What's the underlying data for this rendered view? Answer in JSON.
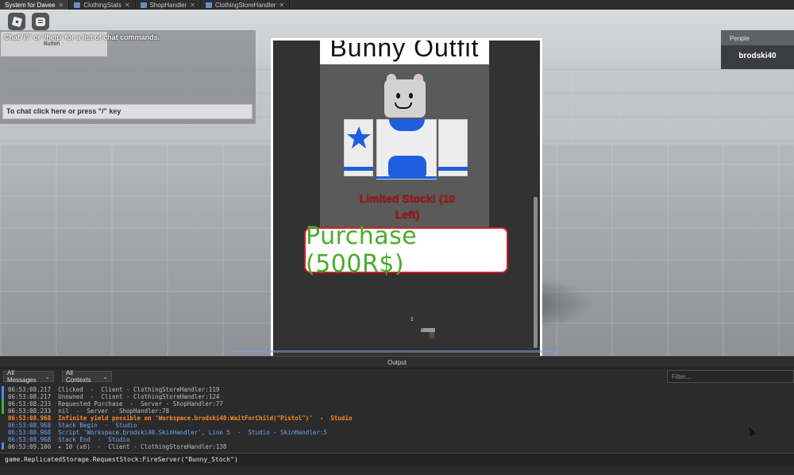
{
  "tabs": [
    {
      "label": "System for Davee",
      "active": true
    },
    {
      "label": "ClothingStats",
      "active": false
    },
    {
      "label": "ShopHandler",
      "active": false
    },
    {
      "label": "ClothingStoreHandler",
      "active": false
    }
  ],
  "chat": {
    "system_message": "Chat '/?' or '/help' for a list of chat commands.",
    "button_label": "Button",
    "input_placeholder": "To chat click here or press \"/\" key"
  },
  "people": {
    "title": "People",
    "players": [
      "brodski40"
    ]
  },
  "shop": {
    "title": "Bunny Outfit",
    "stock_text": "Limited Stock! (10 Left)",
    "purchase_label": "Purchase (500R$)",
    "hotbar_slot": "1"
  },
  "output": {
    "title": "Output",
    "filter_messages": "All Messages",
    "filter_contexts": "All Contexts",
    "filter_placeholder": "Filter...",
    "lines": [
      {
        "text": "06:53:08.217  Clicked  -  Client - ClothingStoreHandler:119",
        "kind": "normal"
      },
      {
        "text": "06:53:08.217  Unowned  -  Client - ClothingStoreHandler:124",
        "kind": "normal"
      },
      {
        "text": "06:53:08.233  Requested Purchase  -  Server - ShopHandler:77",
        "kind": "normal"
      },
      {
        "text": "06:53:08.233  nil  -  Server - ShopHandler:78",
        "kind": "normal"
      },
      {
        "text": "06:53:08.968  Infinite yield possible on 'Workspace.brodski40:WaitForChild(\"Pistol\")'  -  Studio",
        "kind": "warn"
      },
      {
        "text": "06:53:08.968  Stack Begin  -  Studio",
        "kind": "info"
      },
      {
        "text": "06:53:08.968  Script 'Workspace.brodski40.SkinHandler', Line 5  -  Studio - SkinHandler:5",
        "kind": "info"
      },
      {
        "text": "06:53:08.968  Stack End  -  Studio",
        "kind": "info"
      },
      {
        "text": "06:53:09.100  ▸ 10 (x6)  -  Client - ClothingStoreHandler:138",
        "kind": "normal"
      }
    ],
    "command": "game.ReplicatedStorage.RequestStock:FireServer(\"Bunny_Stock\")"
  },
  "colors": {
    "purchase_text": "#4aab2c",
    "purchase_border": "#cf1e23",
    "stock_text": "#a5161b",
    "warning": "#ff8a2a",
    "info": "#6ea3ff",
    "outfit_blue": "#1e5ee0"
  },
  "icons": [
    "roblox-menu-icon",
    "chat-icon",
    "script-tab-icon",
    "close-icon",
    "star-icon",
    "pistol-icon",
    "chevron-down-icon",
    "mouse-cursor-icon"
  ]
}
